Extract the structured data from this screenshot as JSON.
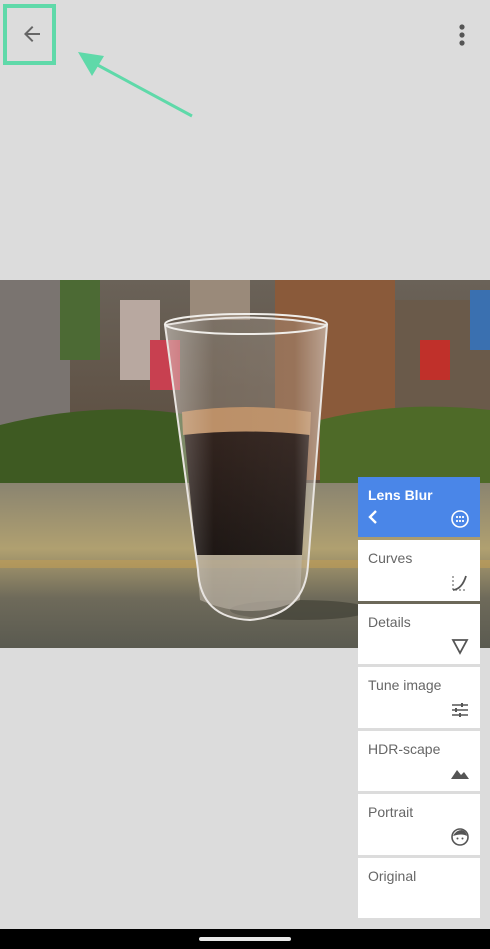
{
  "toolbar": {
    "back_icon": "arrow-left-icon",
    "more_icon": "more-vertical-icon"
  },
  "annotation": {
    "highlight_color": "#5fd9a9"
  },
  "tools": [
    {
      "label": "Lens Blur",
      "icon": "lens-blur-icon",
      "active": true
    },
    {
      "label": "Curves",
      "icon": "curves-icon"
    },
    {
      "label": "Details",
      "icon": "details-triangle-icon"
    },
    {
      "label": "Tune image",
      "icon": "tune-sliders-icon"
    },
    {
      "label": "HDR-scape",
      "icon": "mountains-icon"
    },
    {
      "label": "Portrait",
      "icon": "face-icon"
    },
    {
      "label": "Original",
      "icon": ""
    }
  ],
  "colors": {
    "accent": "#4a86e8",
    "background": "#dcdcdc"
  }
}
